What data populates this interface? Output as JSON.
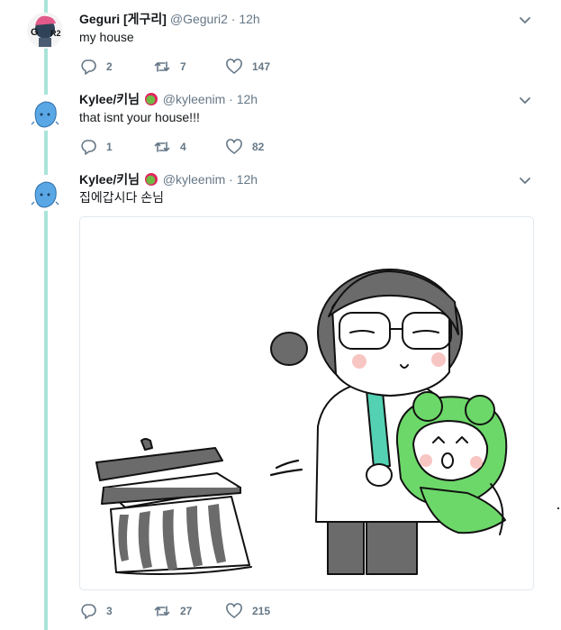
{
  "tweets": [
    {
      "name": "Geguri [게구리]",
      "handle": "@Geguri2",
      "dot": "·",
      "time": "12h",
      "text": "my house",
      "replies": "2",
      "retweets": "7",
      "likes": "147",
      "has_badge": false
    },
    {
      "name": "Kylee/키님",
      "handle": "@kyleenim",
      "dot": "·",
      "time": "12h",
      "text": "that isnt your house!!!",
      "replies": "1",
      "retweets": "4",
      "likes": "82",
      "has_badge": true
    },
    {
      "name": "Kylee/키님",
      "handle": "@kyleenim",
      "dot": "·",
      "time": "12h",
      "text": "집에갑시다 손님",
      "replies": "3",
      "retweets": "27",
      "likes": "215",
      "has_badge": true,
      "media": "drawing of a character in a lab coat carrying a green frog-hood character away from a trash can"
    }
  ],
  "icons": {
    "reply": "reply-icon",
    "retweet": "retweet-icon",
    "like": "like-icon",
    "menu": "chevron-down-icon",
    "badge": "emoji-badge-icon"
  },
  "colors": {
    "thread_line": "#a8e4d9",
    "muted": "#657786",
    "text": "#14171a",
    "badge_green": "#6fba43",
    "badge_red": "#e0245e"
  }
}
